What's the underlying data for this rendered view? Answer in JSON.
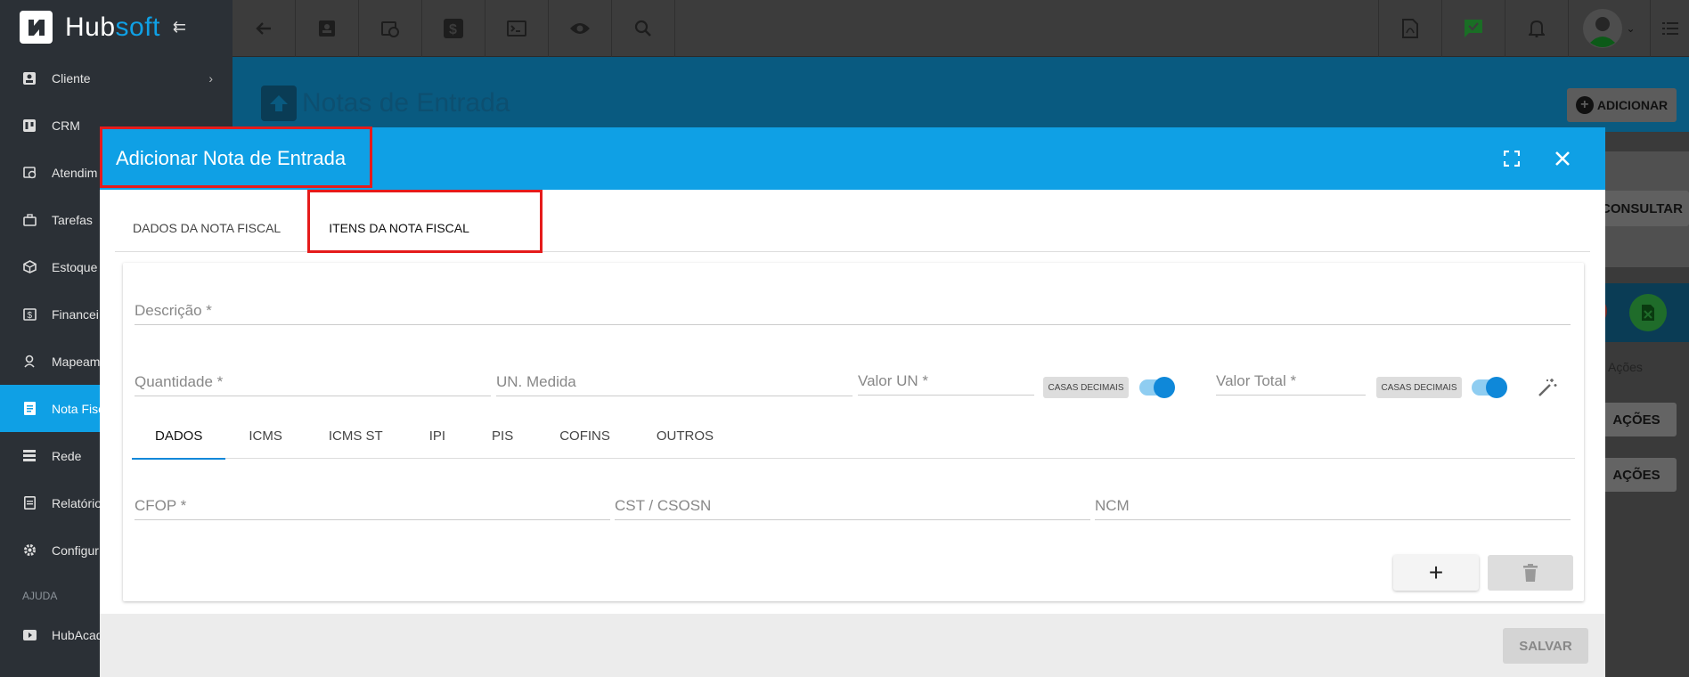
{
  "app": {
    "logo_main": "Hub",
    "logo_accent": "soft"
  },
  "sidebar": {
    "items": [
      {
        "label": "Cliente",
        "icon": "id-card-icon"
      },
      {
        "label": "CRM",
        "icon": "kanban-icon"
      },
      {
        "label": "Atendim",
        "icon": "calendar-clock-icon"
      },
      {
        "label": "Tarefas",
        "icon": "briefcase-icon"
      },
      {
        "label": "Estoque",
        "icon": "box-icon"
      },
      {
        "label": "Financei",
        "icon": "dollar-icon"
      },
      {
        "label": "Mapeam",
        "icon": "map-pin-icon"
      },
      {
        "label": "Nota Fisc",
        "icon": "document-icon"
      },
      {
        "label": "Rede",
        "icon": "network-icon"
      },
      {
        "label": "Relatório",
        "icon": "report-icon"
      },
      {
        "label": "Configur",
        "icon": "gear-icon"
      }
    ],
    "section_help": "AJUDA",
    "help_item": "HubAcad",
    "active_index": 7
  },
  "page": {
    "title": "Notas de Entrada",
    "add_button": "ADICIONAR",
    "consultar": "CONSULTAR",
    "acoes_label": "Ações",
    "acoes_button": "AÇÕES"
  },
  "modal": {
    "title": "Adicionar Nota de Entrada",
    "tabs": [
      "DADOS DA NOTA FISCAL",
      "ITENS DA NOTA FISCAL"
    ],
    "active_tab": 1,
    "fields": {
      "descricao": "Descrição *",
      "quantidade": "Quantidade *",
      "un_medida": "UN. Medida",
      "valor_un": "Valor UN *",
      "valor_total": "Valor Total *",
      "casas_decimais": "CASAS DECIMAIS",
      "cfop": "CFOP *",
      "cst": "CST / CSOSN",
      "ncm": "NCM"
    },
    "subtabs": [
      "DADOS",
      "ICMS",
      "ICMS ST",
      "IPI",
      "PIS",
      "COFINS",
      "OUTROS"
    ],
    "add_symbol": "+",
    "save": "SALVAR"
  },
  "colors": {
    "accent": "#0fa0e5",
    "highlight": "#e51b1b",
    "sidebar": "#2b3036"
  }
}
